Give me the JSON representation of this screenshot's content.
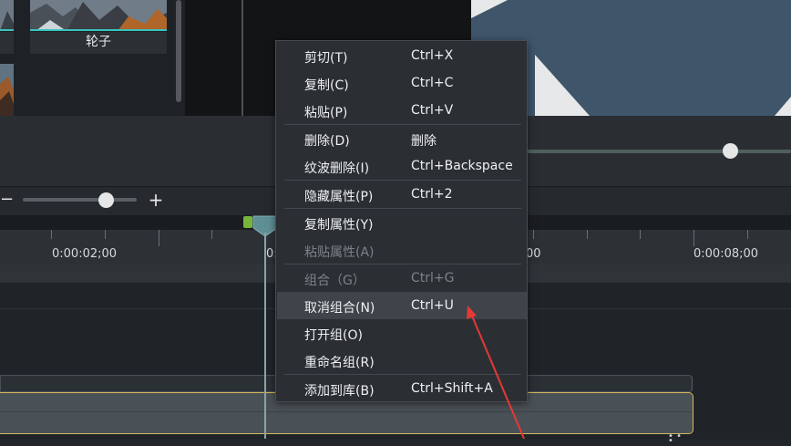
{
  "library": {
    "thumb_label": "轮子"
  },
  "timeline": {
    "ruler_labels": [
      "0:00:02;00",
      "0:",
      "00",
      "0:00:08;00"
    ],
    "zoom_minus": "−",
    "zoom_plus": "+"
  },
  "context_menu": {
    "items": [
      {
        "label": "剪切(T)",
        "shortcut": "Ctrl+X",
        "enabled": true
      },
      {
        "label": "复制(C)",
        "shortcut": "Ctrl+C",
        "enabled": true
      },
      {
        "label": "粘贴(P)",
        "shortcut": "Ctrl+V",
        "enabled": true
      },
      {
        "label": "删除(D)",
        "shortcut": "删除",
        "enabled": true
      },
      {
        "label": "纹波删除(I)",
        "shortcut": "Ctrl+Backspace",
        "enabled": true
      },
      {
        "label": "隐藏属性(P)",
        "shortcut": "Ctrl+2",
        "enabled": true
      },
      {
        "label": "复制属性(Y)",
        "shortcut": "",
        "enabled": true
      },
      {
        "label": "粘贴属性(A)",
        "shortcut": "",
        "enabled": false
      },
      {
        "label": "组合（G）",
        "shortcut": "Ctrl+G",
        "enabled": false
      },
      {
        "label": "取消组合(N)",
        "shortcut": "Ctrl+U",
        "enabled": true,
        "highlighted": true
      },
      {
        "label": "打开组(O)",
        "shortcut": "",
        "enabled": true
      },
      {
        "label": "重命名组(R)",
        "shortcut": "",
        "enabled": true
      },
      {
        "label": "添加到库(B)",
        "shortcut": "Ctrl+Shift+A",
        "enabled": true
      }
    ]
  },
  "colors": {
    "accent_teal": "#38c4c0",
    "annotation_red": "#e53935",
    "clip_border": "#d4b85a",
    "playhead_green": "#76b43b"
  }
}
